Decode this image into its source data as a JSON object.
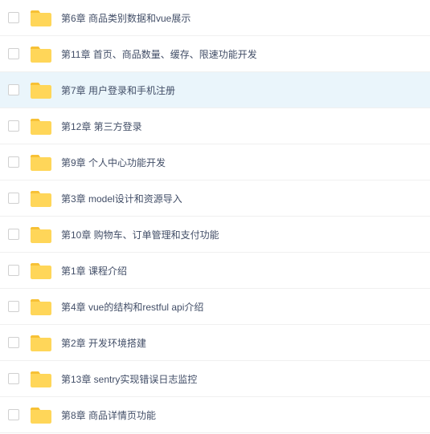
{
  "files": [
    {
      "name": "第6章 商品类别数据和vue展示",
      "highlighted": false
    },
    {
      "name": "第11章 首页、商品数量、缓存、限速功能开发",
      "highlighted": false
    },
    {
      "name": "第7章 用户登录和手机注册",
      "highlighted": true
    },
    {
      "name": "第12章 第三方登录",
      "highlighted": false
    },
    {
      "name": "第9章 个人中心功能开发",
      "highlighted": false
    },
    {
      "name": "第3章 model设计和资源导入",
      "highlighted": false
    },
    {
      "name": "第10章 购物车、订单管理和支付功能",
      "highlighted": false
    },
    {
      "name": "第1章 课程介绍",
      "highlighted": false
    },
    {
      "name": "第4章 vue的结构和restful api介绍",
      "highlighted": false
    },
    {
      "name": "第2章 开发环境搭建",
      "highlighted": false
    },
    {
      "name": "第13章 sentry实现错误日志监控",
      "highlighted": false
    },
    {
      "name": "第8章 商品详情页功能",
      "highlighted": false
    }
  ]
}
